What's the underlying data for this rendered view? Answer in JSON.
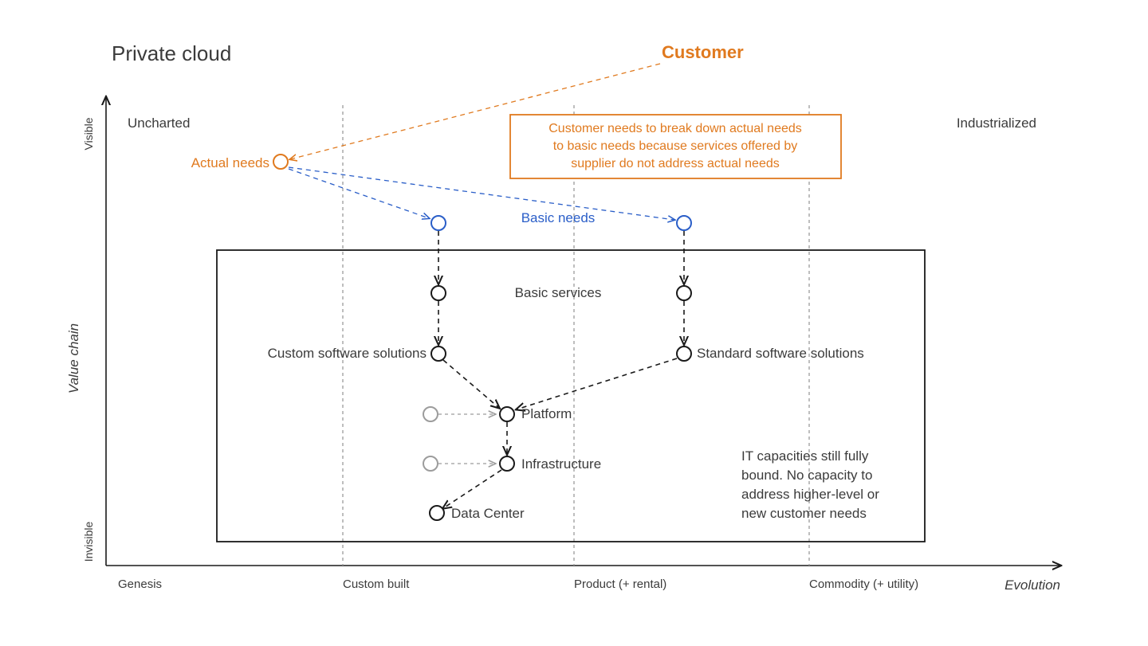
{
  "title": "Private cloud",
  "axes": {
    "y_label": "Value chain",
    "x_label": "Evolution",
    "y_ticks": [
      "Visible",
      "Invisible"
    ],
    "x_ticks": [
      "Genesis",
      "Custom built",
      "Product (+ rental)",
      "Commodity (+ utility)"
    ]
  },
  "regions": {
    "uncharted": "Uncharted",
    "industrialized": "Industrialized"
  },
  "customer_label": "Customer",
  "annotation_box": [
    "Customer needs to break down actual needs",
    "to basic needs because services offered by",
    "supplier do not address actual needs"
  ],
  "nodes": {
    "actual_needs": "Actual needs",
    "basic_needs": "Basic needs",
    "basic_services": "Basic services",
    "custom_sw": "Custom software solutions",
    "standard_sw": "Standard software solutions",
    "platform": "Platform",
    "infrastructure": "Infrastructure",
    "data_center": "Data Center"
  },
  "it_note": [
    "IT capacities still fully",
    "bound. No capacity to",
    "address higher-level or",
    "new customer needs"
  ],
  "chart_data": {
    "type": "wardley-map",
    "evolution_stages": [
      "Genesis",
      "Custom built",
      "Product (+ rental)",
      "Commodity (+ utility)"
    ],
    "visibility_axis": [
      "Invisible",
      "Visible"
    ],
    "anchor": {
      "name": "Customer",
      "stage": "Product (+ rental)"
    },
    "components": [
      {
        "name": "Actual needs",
        "stage": "Genesis-to-Custom",
        "visibility": "high",
        "color": "orange"
      },
      {
        "name": "Basic needs (1)",
        "stage": "Custom built",
        "visibility": "high-mid",
        "color": "blue"
      },
      {
        "name": "Basic needs (2)",
        "stage": "Product (+ rental)",
        "visibility": "high-mid",
        "color": "blue"
      },
      {
        "name": "Basic services (1)",
        "stage": "Custom built",
        "visibility": "mid"
      },
      {
        "name": "Basic services (2)",
        "stage": "Product (+ rental)",
        "visibility": "mid"
      },
      {
        "name": "Custom software solutions",
        "stage": "Custom built",
        "visibility": "mid"
      },
      {
        "name": "Standard software solutions",
        "stage": "Product (+ rental)",
        "visibility": "mid"
      },
      {
        "name": "Platform",
        "stage": "Custom built+",
        "visibility": "mid-low"
      },
      {
        "name": "Infrastructure",
        "stage": "Custom built+",
        "visibility": "low-mid"
      },
      {
        "name": "Data Center",
        "stage": "Custom built",
        "visibility": "low"
      }
    ],
    "links": [
      [
        "Customer",
        "Actual needs"
      ],
      [
        "Actual needs",
        "Basic needs (1)"
      ],
      [
        "Actual needs",
        "Basic needs (2)"
      ],
      [
        "Basic needs (1)",
        "Basic services (1)"
      ],
      [
        "Basic needs (2)",
        "Basic services (2)"
      ],
      [
        "Basic services (1)",
        "Custom software solutions"
      ],
      [
        "Basic services (2)",
        "Standard software solutions"
      ],
      [
        "Custom software solutions",
        "Platform"
      ],
      [
        "Standard software solutions",
        "Platform"
      ],
      [
        "Platform",
        "Infrastructure"
      ],
      [
        "Infrastructure",
        "Data Center"
      ]
    ],
    "supplier_box_spans": [
      "Custom built",
      "Commodity (+ utility)"
    ]
  }
}
